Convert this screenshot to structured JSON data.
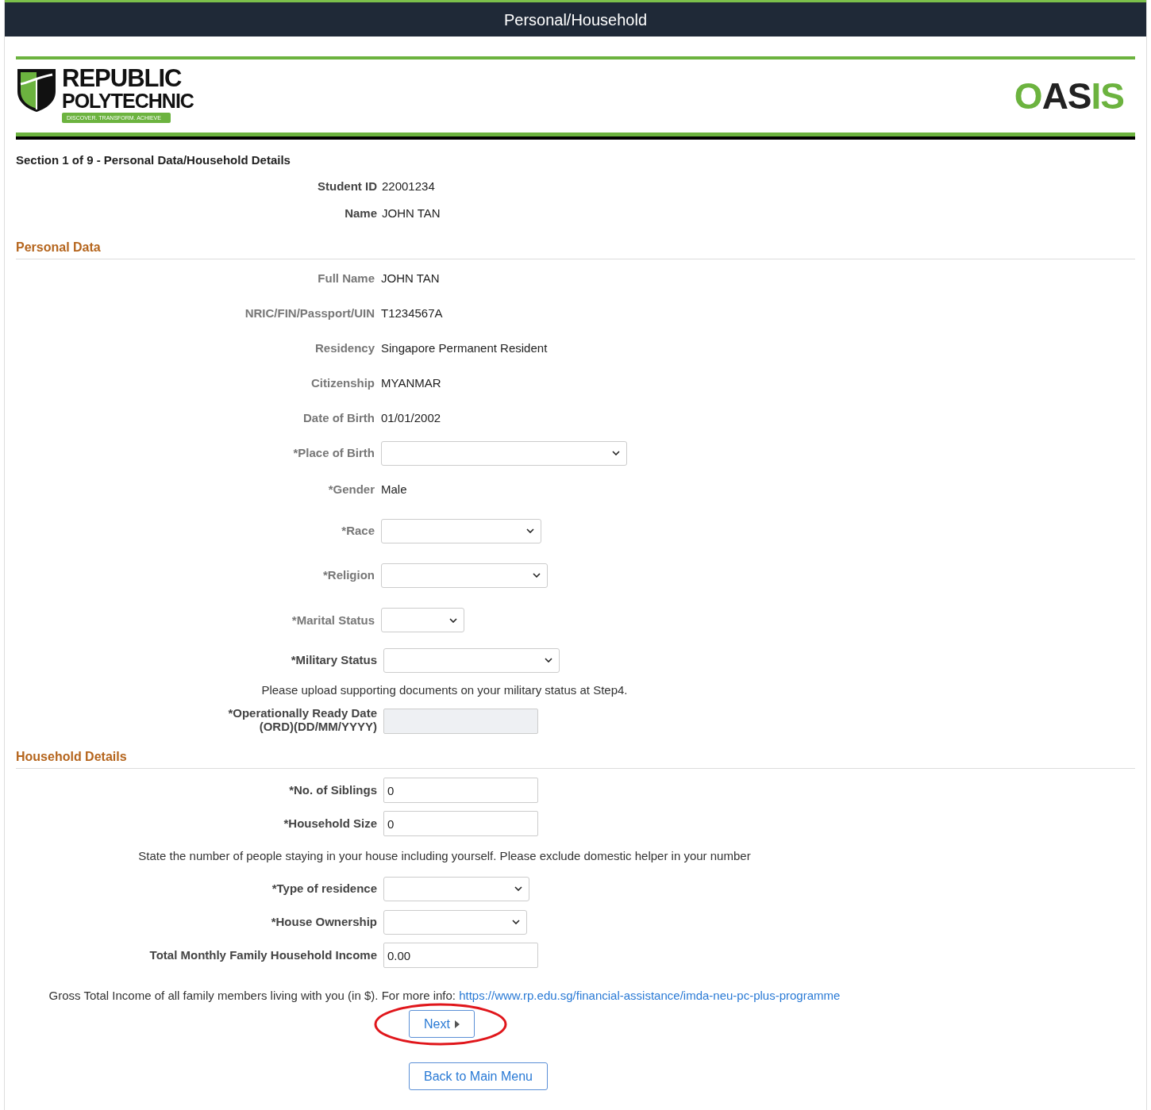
{
  "header": {
    "title": "Personal/Household"
  },
  "logo": {
    "line1": "REPUBLIC",
    "line2": "POLYTECHNIC",
    "tagline": "DISCOVER. TRANSFORM. ACHIEVE"
  },
  "app_logo": [
    {
      "text": "O",
      "color": "#6cb33f"
    },
    {
      "text": "AS",
      "color": "#222222"
    },
    {
      "text": "IS",
      "color": "#6cb33f"
    }
  ],
  "section_title": "Section 1 of 9 - Personal Data/Household Details",
  "student_info": [
    {
      "label": "Student ID",
      "value": "22001234"
    },
    {
      "label": "Name",
      "value": "JOHN TAN"
    }
  ],
  "personal_data": {
    "heading": "Personal Data",
    "fields": [
      {
        "kind": "text",
        "label": "Full Name",
        "value": "JOHN TAN"
      },
      {
        "kind": "text",
        "label": "NRIC/FIN/Passport/UIN",
        "value": "T1234567A"
      },
      {
        "kind": "text",
        "label": "Residency",
        "value": "Singapore Permanent Resident"
      },
      {
        "kind": "text",
        "label": "Citizenship",
        "value": "MYANMAR"
      },
      {
        "kind": "text",
        "label": "Date of Birth",
        "value": "01/01/2002"
      },
      {
        "kind": "select",
        "label": "*Place of Birth"
      },
      {
        "kind": "text",
        "label": "*Gender",
        "value": "Male"
      },
      {
        "kind": "select",
        "label": "*Race"
      },
      {
        "kind": "select",
        "label": "*Religion"
      },
      {
        "kind": "select",
        "label": "*Marital Status"
      }
    ]
  },
  "military": [
    {
      "kind": "select",
      "label": "*Military Status"
    },
    {
      "kind": "note",
      "text": "Please upload supporting documents on your military status at Step4."
    },
    {
      "kind": "input",
      "label": "*Operationally Ready Date (ORD)(DD/MM/YYYY)",
      "disabled": true
    }
  ],
  "household": {
    "heading": "Household Details",
    "fields": [
      {
        "kind": "input",
        "label": "*No. of Siblings",
        "value": "0",
        "disabled": false
      },
      {
        "kind": "input",
        "label": "*Household Size",
        "value": "0",
        "disabled": false
      },
      {
        "kind": "note",
        "text": "State the number of people staying in your house including yourself. Please exclude domestic helper in your number"
      },
      {
        "kind": "select",
        "label": "*Type of residence"
      },
      {
        "kind": "select",
        "label": "*House Ownership"
      },
      {
        "kind": "input",
        "label": "Total Monthly Family Household Income",
        "value": "0.00",
        "disabled": false
      }
    ]
  },
  "info": {
    "text": "Gross Total Income of all family members living with you (in $). For more info:",
    "link": "https://www.rp.edu.sg/financial-assistance/imda-neu-pc-plus-programme"
  },
  "buttons": {
    "next": "Next",
    "back": "Back to Main Menu"
  }
}
